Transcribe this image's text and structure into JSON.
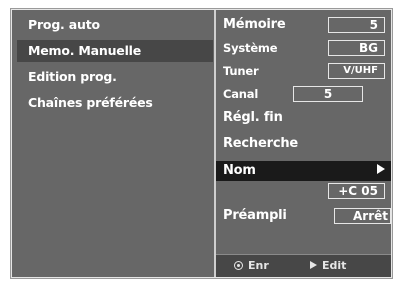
{
  "left_menu": {
    "items": [
      {
        "label": "Prog. auto",
        "selected": false
      },
      {
        "label": "Memo. Manuelle",
        "selected": true
      },
      {
        "label": "Edition prog.",
        "selected": false
      },
      {
        "label": "Chaînes préférées",
        "selected": false
      }
    ]
  },
  "right_menu": {
    "memoire": {
      "label": "Mémoire",
      "value": "5"
    },
    "systeme": {
      "label": "Système",
      "value": "BG"
    },
    "tuner": {
      "label": "Tuner",
      "value": "V/UHF"
    },
    "canal": {
      "label": "Canal",
      "value": "5"
    },
    "regl_fin": {
      "label": "Régl. fin"
    },
    "recherche": {
      "label": "Recherche"
    },
    "nom": {
      "label": "Nom",
      "value": "+C 05",
      "arrow_icon": "right-arrow-icon"
    },
    "preampli": {
      "label": "Préampli",
      "value": "Arrêt"
    }
  },
  "footer": {
    "enr": {
      "icon": "ok-circle-icon",
      "label": "Enr"
    },
    "edit": {
      "icon": "play-arrow-icon",
      "label": "Edit"
    }
  },
  "colors": {
    "panel": "#676767",
    "selected_left": "#474747",
    "selected_right": "#1a1a1a",
    "frame": "#e6e6e6",
    "text": "#ffffff"
  }
}
